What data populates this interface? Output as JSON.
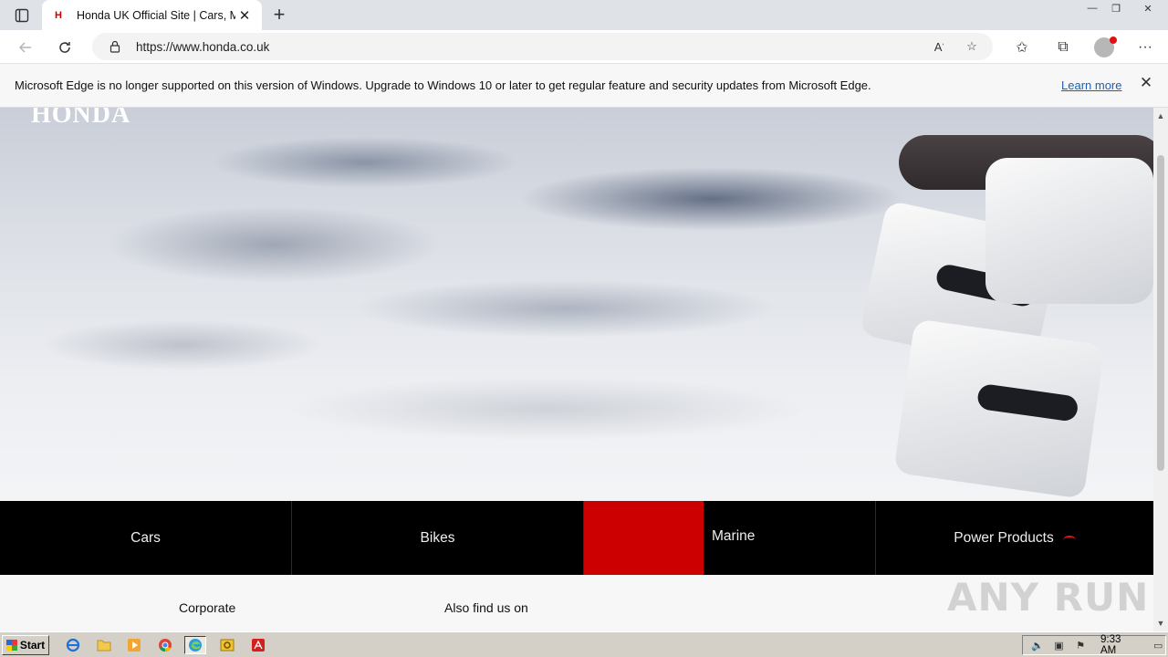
{
  "browser": {
    "tab": {
      "title": "Honda UK Official Site | Cars, Mo",
      "favicon": "honda-h-icon"
    },
    "url": "https://www.honda.co.uk",
    "window_controls": [
      "minimize-icon",
      "restore-icon",
      "close-icon"
    ]
  },
  "infobar": {
    "message": "Microsoft Edge is no longer supported on this version of Windows. Upgrade to Windows 10 or later to get regular feature and security updates from Microsoft Edge.",
    "link": "Learn more"
  },
  "page": {
    "logo": "HONDA",
    "nav_tiles": [
      {
        "label": "Cars"
      },
      {
        "label": "Bikes"
      },
      {
        "label": "Marine"
      },
      {
        "label": "Power Products"
      }
    ],
    "footer": {
      "corporate": "Corporate",
      "also_find": "Also find us on"
    },
    "watermark": "ANY RUN"
  },
  "taskbar": {
    "start": "Start",
    "apps": [
      "ie-icon",
      "explorer-folder-icon",
      "media-player-icon",
      "chrome-icon",
      "edge-icon",
      "outlook-icon",
      "acrobat-icon"
    ],
    "clock": "9:33 AM"
  },
  "colors": {
    "honda_red": "#cc0000",
    "nav_background": "#000000",
    "link_blue": "#1a5fb4"
  }
}
